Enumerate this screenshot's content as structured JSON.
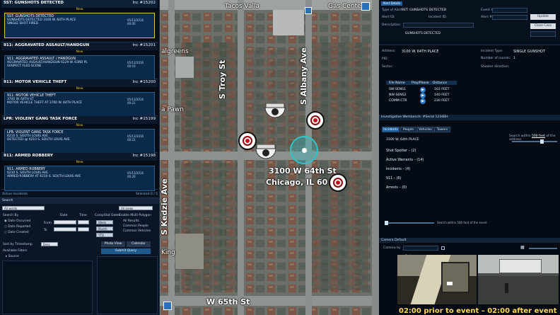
{
  "alerts_panel": {
    "alerts": [
      {
        "header": "SST: GUNSHOTS DETECTED",
        "code": "Inc #15202",
        "status": "New",
        "title": "SST: GUNSHOTS DETECTED",
        "line1": "GUNSHOTS DETECTED 3100 W. 64TH PLACE",
        "line2": "SINGLE SHOT FIRED",
        "date": "05/13/2016",
        "time": "00:00"
      },
      {
        "header": "911: AGGRAVATED ASSAULT/HANDGUN",
        "code": "Inc #15201",
        "status": "New",
        "title": "911: AGGRAVATED ASSAULT / HANDGUN",
        "line1": "AGGRAVATED ASSAULT/HANDGUN 6129 W. 63RD PL",
        "line2": "SUSPECT FLED SCENE",
        "date": "05/13/2016",
        "time": "00:10"
      },
      {
        "header": "911: MOTOR VEHICLE THEFT",
        "code": "Inc #15200",
        "status": "New",
        "title": "911: MOTOR VEHICLE THEFT",
        "line1": "3700 W. 64TH ST",
        "line2": "MOTOR VEHICLE THEFT AT 3700 W. 64TH PLACE",
        "date": "05/13/2016",
        "time": "00:21"
      },
      {
        "header": "LPR: VIOLENT GANG TASK FORCE",
        "code": "Inc #15199",
        "status": "New",
        "title": "LPR: VIOLENT GANG TASK FORCE",
        "line1": "6210 S. SOUTH LOUIS AVE",
        "line2": "DETECTED @ 6210 S. SOUTH LOUIS AVE",
        "date": "05/13/2016",
        "time": "00:22"
      },
      {
        "header": "911: ARMED ROBBERY",
        "code": "Inc #15198",
        "status": "New",
        "title": "911: ARMED ROBBERY",
        "line1": "6210 S. SOUTH LOUIS AVE",
        "line2": "ARMED ROBBERY AT 6210 S. SOUTH LOUIS AVE",
        "date": "05/13/2016",
        "time": "00:29"
      }
    ],
    "footer_left": "Active Incidents",
    "footer_right": "Selected 0 / 5"
  },
  "search_panel": {
    "title": "Search",
    "all_words": "All words",
    "search_by": "Search By",
    "date_occurred": "Date Occurred",
    "date_reported": "Date Reported",
    "date_created": "Date Created",
    "from": "From",
    "to": "To",
    "date_col": "Date",
    "time_col": "Time",
    "compstat": "CompStat Dates",
    "all_areas": "All areas",
    "enable_polygon": "Enable Multi-Polygon",
    "all_results": "All Results",
    "common_people": "Common People",
    "common_vehicles": "Common Vehicles",
    "sort_by": "Sort by Timestamp",
    "sort_value": "Desc",
    "available_filters": "Available Filters",
    "source": "Source",
    "photo_view": "Photo View",
    "calendar": "Calendar",
    "submit": "Submit Query",
    "week": "Week",
    "month": "Month",
    "ytd": "YTD"
  },
  "map": {
    "top_labels": [
      "Tacos Valla",
      "Gas Center"
    ],
    "streets": [
      "S Troy St",
      "S Albany Ave",
      "S Kedzie Ave",
      "W 65th St"
    ],
    "pois": [
      "algreens",
      "a Pawn",
      "King"
    ],
    "address_line1": "3100 W 64th St",
    "address_line2": "Chicago, IL 60"
  },
  "detail_panel": {
    "header": "Alert Details",
    "type_of_alert_label": "Type of Alert:",
    "type_of_alert": "SST: GUNSHOTS DETECTED",
    "alert_id_label": "Alert ID:",
    "incident_id_label": "Incident ID:",
    "event_label": "Event #:",
    "alert_num_label": "Alert #:",
    "description_label": "Description:",
    "description": "GUNSHOTS DETECTED",
    "btn_update": "Update",
    "btn_close": "Close Case",
    "address_label": "Address:",
    "address": "3100 W. 64TH PLACE",
    "incident_type_label": "Incident Type:",
    "incident_type": "SINGLE GUNSHOT",
    "pid_label": "PID:",
    "rounds_label": "Number of rounds:",
    "rounds": "1",
    "sector_label": "Sector:",
    "shooter_label": "Shooter direction:",
    "sensor_headers": [
      "File Name",
      "Play/Pause",
      "Distance"
    ],
    "sensors": [
      {
        "name": "SW-SENS1",
        "distance": "102 FEET"
      },
      {
        "name": "NW-SENS2",
        "distance": "140 FEET"
      },
      {
        "name": "COMM-CTR",
        "distance": "230 FEET"
      }
    ]
  },
  "workbench": {
    "title": "Investigative Workbench: #Serial 1234BH",
    "tabs": [
      "Incidents",
      "People",
      "Vehicles",
      "Towers"
    ],
    "search_within": "Search within",
    "radius": "500 feet",
    "of_address": "of the address",
    "address": "3100 W. 64th PLACE",
    "items": [
      "Shot Spotter – (2)",
      "Active Warrants – (14)",
      "Incidents – (4)",
      "911 – (6)",
      "Arrests – (0)"
    ],
    "slider_hint": "Search within 500 feet of the event"
  },
  "camera": {
    "title": "Camera Default",
    "camera_by": "Camera by",
    "select": "Select",
    "caption": "02:00 prior to event – 02:00 after event"
  }
}
